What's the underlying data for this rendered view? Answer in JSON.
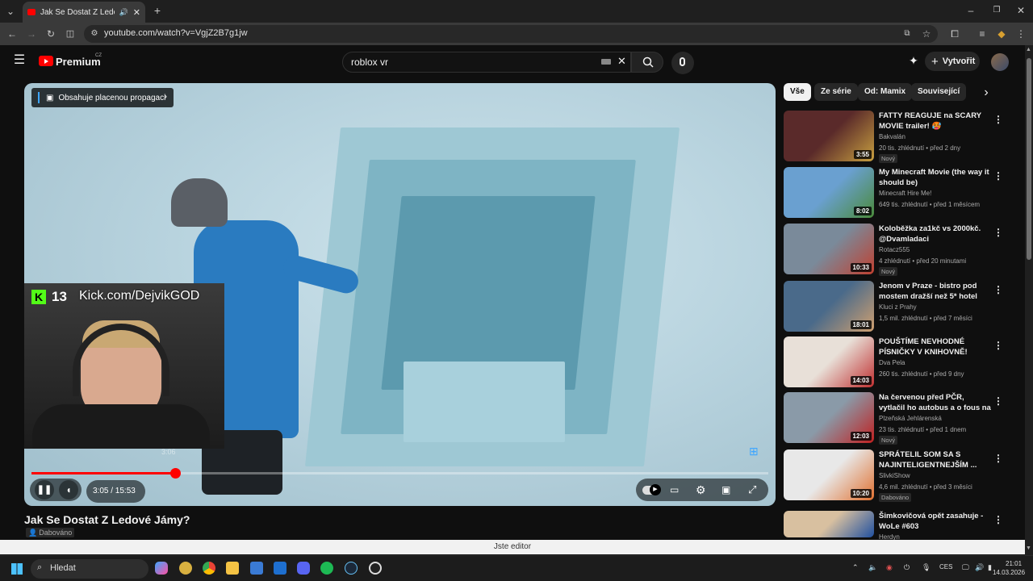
{
  "browser": {
    "tab_title": "Jak Se Dostat Z Ledové Jámy",
    "url": "youtube.com/watch?v=VgjZ2B7g1jw"
  },
  "header": {
    "logo_text": "Premium",
    "logo_region": "CZ",
    "search_value": "roblox vr",
    "create_label": "Vytvořit"
  },
  "player": {
    "promo_text": "Obsahuje placenou propagaci",
    "stream_count": "13",
    "stream_url": "Kick.com/DejvikGOD",
    "time_current": "3:05",
    "time_total": "15:53",
    "time_text": "3:05 / 15:53",
    "hover_time": "3:06",
    "progress_fraction": 0.195
  },
  "video": {
    "title": "Jak Se Dostat Z Ledové Jámy?",
    "badge": "Dabováno"
  },
  "chips": [
    "Vše",
    "Ze série",
    "Od: Mamix",
    "Související"
  ],
  "recommendations": [
    {
      "title": "FATTY REAGUJE na SCARY MOVIE trailer! 🥵",
      "channel": "Bakvalán",
      "meta": "20 tis. zhlédnutí • před 2 dny",
      "badge": "Nový",
      "duration": "3:55",
      "color1": "#5a2a2a",
      "color2": "#c8a040"
    },
    {
      "title": "My Minecraft Movie (the way it should be)",
      "channel": "Minecraft Hire Me!",
      "meta": "649 tis. zhlédnutí • před 1 měsícem",
      "badge": "",
      "duration": "8:02",
      "color1": "#6aa0d0",
      "color2": "#4a8a3a"
    },
    {
      "title": "Koloběžka za1kč vs 2000kč. @Dvamladaci",
      "channel": "Rotacz555",
      "meta": "4 zhlédnutí • před 20 minutami",
      "badge": "Nový",
      "duration": "10:33",
      "color1": "#7a8a9a",
      "color2": "#c04030"
    },
    {
      "title": "Jenom v Praze - bistro pod mostem dražší než 5* hotel",
      "channel": "Kluci z Prahy",
      "meta": "1,5 mil. zhlédnutí • před 7 měsíci",
      "badge": "",
      "duration": "18:01",
      "color1": "#4a6a8a",
      "color2": "#d0a070"
    },
    {
      "title": "POUŠTÍME NEVHODNÉ PÍSNIČKY V KNIHOVNĚ!",
      "channel": "Dva Pela",
      "meta": "260 tis. zhlédnutí • před 9 dny",
      "badge": "",
      "duration": "14:03",
      "color1": "#e8e0d8",
      "color2": "#c03030"
    },
    {
      "title": "Na červenou před PČR, vytlačil ho autobus a o fous na dálnici ...",
      "channel": "Plzeňská Jehlárenská",
      "meta": "23 tis. zhlédnutí • před 1 dnem",
      "badge": "Nový",
      "duration": "12:03",
      "color1": "#8a9aa8",
      "color2": "#c02020"
    },
    {
      "title": "SPRÁTELIL SOM SA S NAJINTELIGENTNEJŠÍM ...",
      "channel": "SlivkiShow",
      "meta": "4,6 mil. zhlédnutí • před 3 měsíci",
      "badge": "Dabováno",
      "duration": "10:20",
      "color1": "#e8e8e8",
      "color2": "#e07030"
    },
    {
      "title": "Šimkovičová opět zasahuje - WoLe #603",
      "channel": "Herdyn",
      "meta": "",
      "badge": "",
      "duration": "",
      "color1": "#d8c0a0",
      "color2": "#2050a0"
    }
  ],
  "editor_bar": "Jste editor",
  "taskbar": {
    "search_label": "Hledat",
    "lang": "CES",
    "time": "21:01",
    "date": "14.03.2026"
  }
}
